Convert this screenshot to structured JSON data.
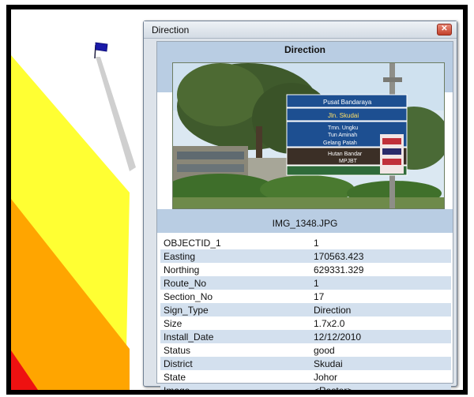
{
  "window": {
    "title": "Direction"
  },
  "popup": {
    "header": "Direction",
    "caption": "IMG_1348.JPG",
    "photo_signs": [
      "Pusat Bandaraya",
      "Jln. Skudai",
      "Tmn. Ungku",
      "Tun Aminah",
      "Gelang Patah",
      "Hutan Bandar",
      "MPJBT"
    ],
    "attributes": [
      {
        "key": "OBJECTID_1",
        "value": "1"
      },
      {
        "key": "Easting",
        "value": "170563.423"
      },
      {
        "key": "Northing",
        "value": "629331.329"
      },
      {
        "key": "Route_No",
        "value": "1"
      },
      {
        "key": "Section_No",
        "value": "17"
      },
      {
        "key": "Sign_Type",
        "value": "Direction"
      },
      {
        "key": "Size",
        "value": "1.7x2.0"
      },
      {
        "key": "Install_Date",
        "value": "12/12/2010"
      },
      {
        "key": "Status",
        "value": "good"
      },
      {
        "key": "District",
        "value": "Skudai"
      },
      {
        "key": "State",
        "value": "Johor"
      },
      {
        "key": "Image",
        "value": "<Raster>"
      }
    ]
  },
  "map": {
    "marker_icon": "flag-icon",
    "colors": {
      "yellow_band": "#ffff33",
      "orange_band": "#ffa500",
      "red_band": "#ee1111",
      "link_line": "#c8c8c8",
      "flag": "#1a1aa8"
    }
  }
}
